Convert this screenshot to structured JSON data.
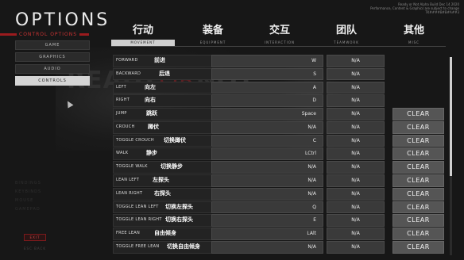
{
  "title": "OPTIONS",
  "subtitle": "CONTROL OPTIONS",
  "top_info": [
    "Ready or Not Alpha Build Dec 14 2020",
    "Performance, Content & Graphics are subject to change",
    "TK####B#B#A##3"
  ],
  "background_logo": {
    "main": "READY",
    "accent": "OR",
    "tail": "NOT"
  },
  "sidebar": {
    "items": [
      {
        "label": "GAME",
        "active": false
      },
      {
        "label": "GRAPHICS",
        "active": false
      },
      {
        "label": "AUDIO",
        "active": false
      },
      {
        "label": "CONTROLS",
        "active": true
      }
    ],
    "faded_items": [
      "BINDINGS",
      "KEYBINDS",
      "MOUSE",
      "GAMEPAD"
    ],
    "exit_label": "EXIT",
    "bottom_hint": "ESC BACK"
  },
  "tabs": [
    {
      "cn": "行动",
      "en": "MOVEMENT",
      "active": true
    },
    {
      "cn": "装备",
      "en": "EQUIPMENT",
      "active": false
    },
    {
      "cn": "交互",
      "en": "INTERACTION",
      "active": false
    },
    {
      "cn": "团队",
      "en": "TEAMWORK",
      "active": false
    },
    {
      "cn": "其他",
      "en": "MISC",
      "active": false
    }
  ],
  "bindings": [
    {
      "en": "FORWARD",
      "cn": "前进",
      "key": "W",
      "alt": "N/A",
      "clear": ""
    },
    {
      "en": "BACKWARD",
      "cn": "后退",
      "key": "S",
      "alt": "N/A",
      "clear": ""
    },
    {
      "en": "LEFT",
      "cn": "向左",
      "key": "A",
      "alt": "N/A",
      "clear": ""
    },
    {
      "en": "RIGHT",
      "cn": "向右",
      "key": "D",
      "alt": "N/A",
      "clear": ""
    },
    {
      "en": "JUMP",
      "cn": "跳跃",
      "key": "Space",
      "alt": "N/A",
      "clear": "CLEAR"
    },
    {
      "en": "CROUCH",
      "cn": "蹲伏",
      "key": "N/A",
      "alt": "N/A",
      "clear": "CLEAR"
    },
    {
      "en": "TOGGLE CROUCH",
      "cn": "切换蹲伏",
      "key": "C",
      "alt": "N/A",
      "clear": "CLEAR"
    },
    {
      "en": "WALK",
      "cn": "静步",
      "key": "LCtrl",
      "alt": "N/A",
      "clear": "CLEAR"
    },
    {
      "en": "TOGGLE WALK",
      "cn": "切换静步",
      "key": "N/A",
      "alt": "N/A",
      "clear": "CLEAR"
    },
    {
      "en": "LEAN LEFT",
      "cn": "左探头",
      "key": "N/A",
      "alt": "N/A",
      "clear": "CLEAR"
    },
    {
      "en": "LEAN RIGHT",
      "cn": "右探头",
      "key": "N/A",
      "alt": "N/A",
      "clear": "CLEAR"
    },
    {
      "en": "TOGGLE LEAN LEFT",
      "cn": "切换左探头",
      "key": "Q",
      "alt": "N/A",
      "clear": "CLEAR"
    },
    {
      "en": "TOGGLE LEAN RIGHT",
      "cn": "切换右探头",
      "key": "E",
      "alt": "N/A",
      "clear": "CLEAR"
    },
    {
      "en": "FREE LEAN",
      "cn": "自由倾身",
      "key": "LAlt",
      "alt": "N/A",
      "clear": "CLEAR"
    },
    {
      "en": "TOGGLE FREE LEAN",
      "cn": "切换自由倾身",
      "key": "N/A",
      "alt": "N/A",
      "clear": "CLEAR"
    }
  ],
  "colors": {
    "accent_red": "#9b1b1e",
    "active_tab": "#cfcfcf",
    "background": "#171717"
  }
}
